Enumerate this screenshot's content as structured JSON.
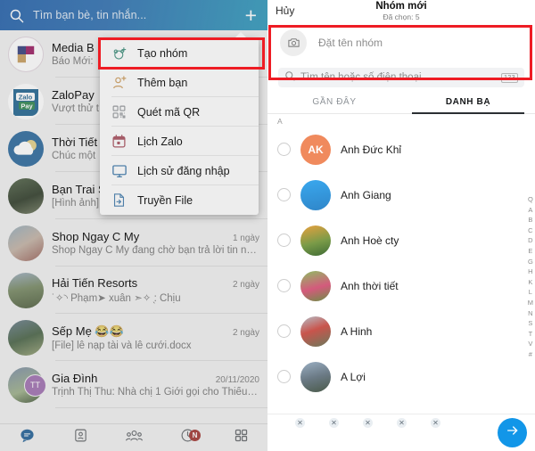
{
  "left_panel": {
    "header": {
      "search_placeholder": "Tìm bạn bè, tin nhắn...",
      "search_icon": "search-icon",
      "add_icon": "plus-icon",
      "gradient_from": "#1478ef",
      "gradient_to": "#05b3ea"
    },
    "chats": [
      {
        "name": "Media B",
        "preview": "Báo Mới:",
        "time": "",
        "avatar": "media-box-logo"
      },
      {
        "name": "ZaloPay",
        "preview": "Vượt thử t",
        "time": "",
        "avatar": "zalopay-logo"
      },
      {
        "name": "Thời Tiết",
        "preview": "Chúc một",
        "time": "",
        "avatar": "weather-logo"
      },
      {
        "name": "Bạn Trai S",
        "preview": "[Hình ảnh]",
        "time": "",
        "avatar": "photo-1"
      },
      {
        "name": "Shop Ngay C My",
        "preview": "Shop Ngay C My đang chờ bạn trả lời tin nh...",
        "time": "1 ngày",
        "avatar": "photo-2"
      },
      {
        "name": "Hải Tiến Resorts",
        "preview": "˙✧◝ Phạm➤ xuân ➣✧ ̖: Chịu",
        "time": "2 ngày",
        "avatar": "photo-3"
      },
      {
        "name": "Sếp Mẹ 😂😂",
        "preview": "[File] lễ nạp tài và lễ cưới.docx",
        "time": "2 ngày",
        "avatar": "photo-4"
      },
      {
        "name": "Gia Đình",
        "preview": "Trịnh Thị Thu: Nhà chị 1 Giới gọi cho Thiếu ơ...",
        "time": "20/11/2020",
        "avatar": "photo-5",
        "badge": "TT"
      }
    ],
    "bottom_nav": [
      {
        "name": "messages-tab",
        "icon": "chat-bubble-icon",
        "active": true,
        "badge": ""
      },
      {
        "name": "contacts-tab",
        "icon": "contact-card-icon",
        "active": false,
        "badge": ""
      },
      {
        "name": "groups-tab",
        "icon": "people-group-icon",
        "active": false,
        "badge": ""
      },
      {
        "name": "timeline-tab",
        "icon": "clock-icon",
        "active": false,
        "badge": "N"
      },
      {
        "name": "more-tab",
        "icon": "grid-icon",
        "active": false,
        "badge": ""
      }
    ]
  },
  "dropdown_menu": {
    "items": [
      {
        "label": "Tạo nhóm",
        "icon": "create-group-icon",
        "icon_color": "#2aa98b",
        "highlighted": true
      },
      {
        "label": "Thêm bạn",
        "icon": "add-friend-icon",
        "icon_color": "#f2a33c",
        "highlighted": false
      },
      {
        "label": "Quét mã QR",
        "icon": "qr-code-icon",
        "icon_color": "#9aa0a6",
        "highlighted": false
      },
      {
        "label": "Lịch Zalo",
        "icon": "calendar-icon",
        "icon_color": "#e2536b",
        "highlighted": false
      },
      {
        "label": "Lịch sử đăng nhập",
        "icon": "monitor-icon",
        "icon_color": "#2f8fe0",
        "highlighted": false
      },
      {
        "label": "Truyền File",
        "icon": "file-transfer-icon",
        "icon_color": "#2f8fe0",
        "highlighted": false
      }
    ]
  },
  "right_panel": {
    "header": {
      "cancel_label": "Hủy",
      "title": "Nhóm mới",
      "subtitle": "Đã chọn: 5"
    },
    "group_name": {
      "placeholder": "Đặt tên nhóm",
      "camera_icon": "camera-icon"
    },
    "search": {
      "placeholder": "Tìm tên hoặc số điện thoại",
      "icon": "search-icon",
      "keypad_label": "123"
    },
    "tabs": [
      {
        "label": "GẦN ĐÂY",
        "active": false
      },
      {
        "label": "DANH BẠ",
        "active": true
      }
    ],
    "section_letter": "A",
    "contacts": [
      {
        "name": "Anh Đức Khỉ",
        "avatar": "initials",
        "initials": "AK",
        "checked": false
      },
      {
        "name": "Anh Giang",
        "avatar": "photo-1",
        "checked": false
      },
      {
        "name": "Anh Hoè cty",
        "avatar": "photo-2",
        "checked": false
      },
      {
        "name": "Anh thời tiết",
        "avatar": "photo-3",
        "checked": false
      },
      {
        "name": "A Hinh",
        "avatar": "photo-4",
        "checked": false
      },
      {
        "name": "A Lợi",
        "avatar": "photo-5",
        "checked": false
      }
    ],
    "alpha_index": [
      "Q",
      "A",
      "B",
      "C",
      "D",
      "E",
      "G",
      "H",
      "K",
      "L",
      "M",
      "N",
      "S",
      "T",
      "V",
      "#"
    ],
    "selected_bar": {
      "selected": [
        {
          "avatar": "sel-1",
          "remove_icon": "close-icon"
        },
        {
          "avatar": "sel-2",
          "remove_icon": "close-icon"
        },
        {
          "avatar": "sel-3",
          "remove_icon": "close-icon"
        },
        {
          "avatar": "sel-4",
          "remove_icon": "close-icon"
        },
        {
          "avatar": "sel-5",
          "remove_icon": "close-icon"
        }
      ],
      "next_icon": "arrow-right-icon",
      "next_color": "#1296e8"
    }
  },
  "annotations": {
    "box_color": "#ee1c24",
    "boxes": [
      {
        "name": "highlight-tao-nhom"
      },
      {
        "name": "highlight-dat-ten-nhom"
      }
    ]
  }
}
